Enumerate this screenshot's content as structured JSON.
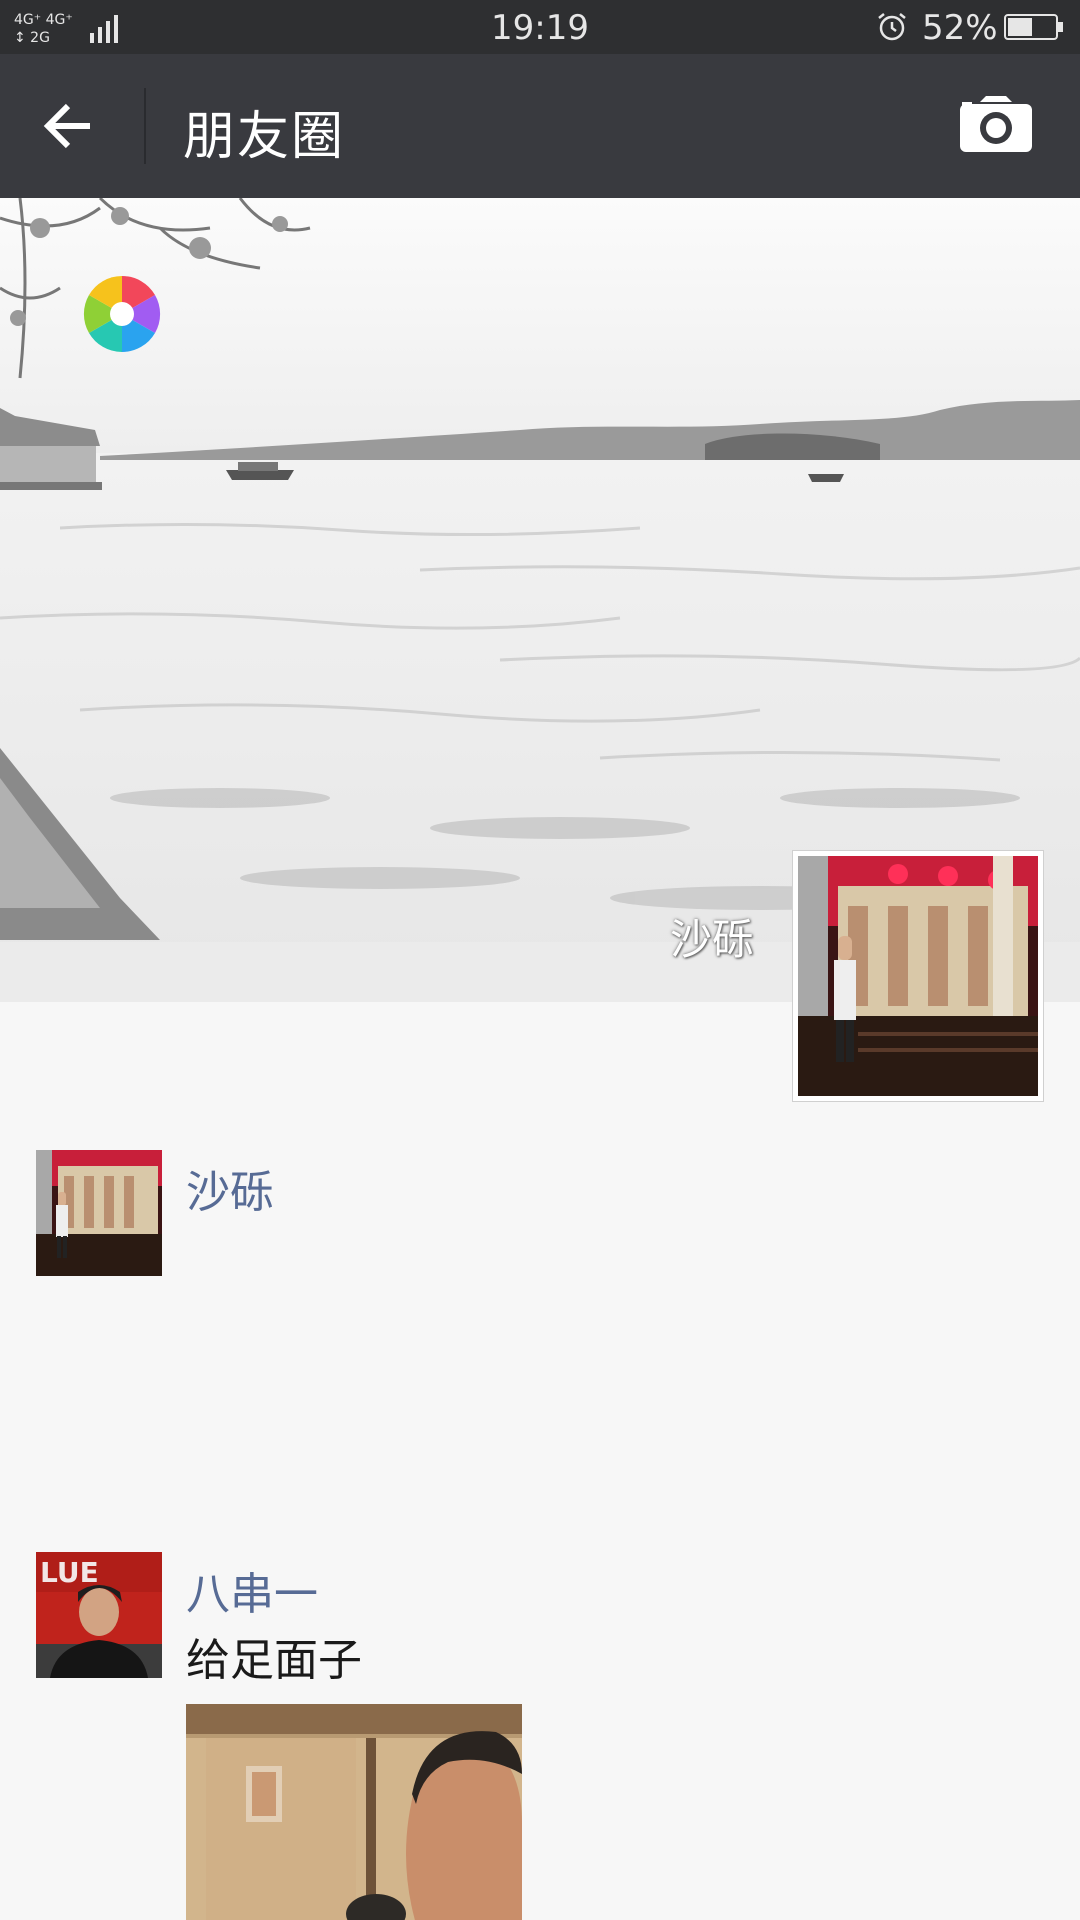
{
  "status_bar": {
    "network": "4G⁺ 4G⁺ 2G",
    "time": "19:19",
    "battery_percent": "52%",
    "battery_level": 0.52,
    "icons": [
      "signal-icon",
      "alarm-icon",
      "battery-icon"
    ]
  },
  "title_bar": {
    "title": "朋友圈",
    "back_icon": "arrow-left-icon",
    "camera_icon": "camera-icon"
  },
  "cover": {
    "user_name": "沙砾",
    "logo_icon": "aperture-logo-icon"
  },
  "feed": [
    {
      "author": "沙砾",
      "text": ""
    },
    {
      "author": "八串一",
      "text": "给足面子"
    }
  ],
  "colors": {
    "status_bar_bg": "#2e2f31",
    "title_bar_bg": "#393a3f",
    "link_name": "#576b95",
    "page_bg": "#f7f7f7"
  }
}
